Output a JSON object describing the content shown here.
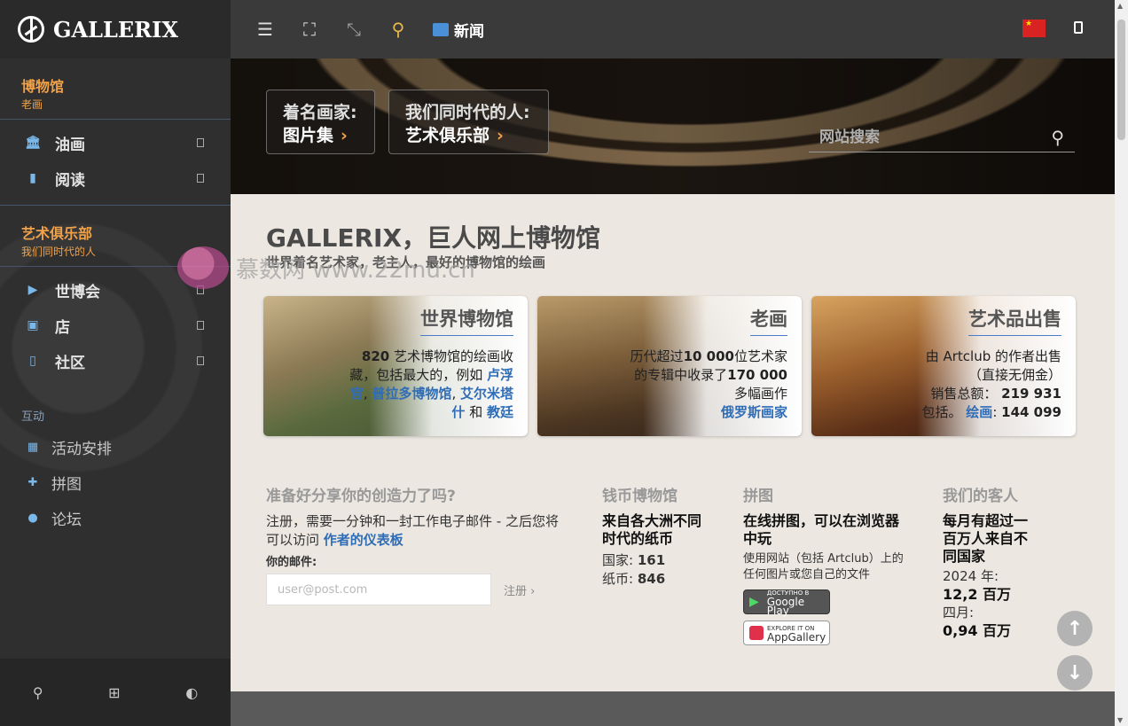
{
  "brand": {
    "name": "GALLERIX"
  },
  "sidebar": {
    "museum": {
      "title": "博物馆",
      "sub": "老画"
    },
    "museum_items": [
      {
        "label": "油画",
        "icon": "museum-icon"
      },
      {
        "label": "阅读",
        "icon": "book-icon"
      }
    ],
    "club": {
      "title": "艺术俱乐部",
      "sub": "我们同时代的人"
    },
    "club_items": [
      {
        "label": "世博会",
        "icon": "play-icon"
      },
      {
        "label": "店",
        "icon": "bag-icon"
      },
      {
        "label": "社区",
        "icon": "square-icon"
      }
    ],
    "interact_label": "互动",
    "interact_items": [
      {
        "label": "活动安排",
        "icon": "calendar-icon"
      },
      {
        "label": "拼图",
        "icon": "puzzle-icon"
      },
      {
        "label": "论坛",
        "icon": "chat-icon"
      }
    ]
  },
  "topbar": {
    "news_label": "新闻"
  },
  "hero": {
    "btn1": {
      "line1": "着名画家:",
      "line2": "图片集"
    },
    "btn2": {
      "line1": "我们同时代的人:",
      "line2": "艺术俱乐部"
    },
    "search_placeholder": "网站搜索"
  },
  "main": {
    "title": "GALLERIX，巨人网上博物馆",
    "subtitle": "世界着名艺术家，老主人，最好的博物馆的绘画"
  },
  "cards": [
    {
      "title": "世界博物馆",
      "count": "820",
      "text1": " 艺术博物馆的绘画收藏，包括最大的，例如 ",
      "link1": "卢浮宫",
      "sep1": ", ",
      "link2": "普拉多博物馆",
      "sep2": ", ",
      "link3": "艾尔米塔什",
      "and": " 和 ",
      "link4": "教廷"
    },
    {
      "title": "老画",
      "text1": "历代超过",
      "num1": "10 000",
      "text2": "位艺术家的专辑中收录了",
      "num2": "170 000",
      "text3": "多幅画作",
      "link1": "俄罗斯画家"
    },
    {
      "title": "艺术品出售",
      "line1": "由 Artclub 的作者出售",
      "line2": "（直接无佣金）",
      "sales_label": "销售总额：",
      "sales_value": "219 931",
      "incl_label": "包括。",
      "incl_link": "绘画",
      "incl_colon": ": ",
      "incl_value": "144 099"
    }
  ],
  "share": {
    "heading": "准备好分享你的创造力了吗?",
    "line1": "注册，需要一分钟和一封工作电子邮件 - 之后您将可以访问 ",
    "link": "作者的仪表板",
    "email_label": "你的邮件:",
    "email_placeholder": "user@post.com",
    "register_label": "注册"
  },
  "coins": {
    "heading": "钱币博物馆",
    "strong": "来自各大洲不同时代的纸币",
    "country_label": "国家:",
    "country_value": "161",
    "notes_label": "纸币:",
    "notes_value": "846"
  },
  "puzzle": {
    "heading": "拼图",
    "strong": "在线拼图，可以在浏览器中玩",
    "text": "使用网站（包括 Artclub）上的任何图片或您自己的文件",
    "gp_small": "ДОСТУПНО В",
    "gp_big": "Google Play",
    "ag_small": "EXPLORE IT ON",
    "ag_big": "AppGallery"
  },
  "guests": {
    "heading": "我们的客人",
    "strong": "每月有超过一百万人来自不同国家",
    "year_label": "2024 年:",
    "year_value": "12,2 百万",
    "month_label": "四月:",
    "month_value": "0,94 百万"
  },
  "watermark": "慕数网 www.22mu.cn",
  "colors": {
    "accent": "#f0a24a",
    "link": "#2f6db6",
    "sidebar": "#2f2f2f",
    "main_bg": "#ece7e1"
  }
}
